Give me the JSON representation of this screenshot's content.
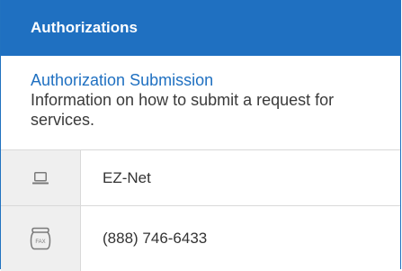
{
  "header": {
    "title": "Authorizations"
  },
  "info": {
    "link_text": "Authorization Submission",
    "description": "Information on how to submit a request for services."
  },
  "rows": [
    {
      "icon": "laptop-icon",
      "label": "EZ-Net"
    },
    {
      "icon": "fax-icon",
      "icon_text": "FAX",
      "label": "(888) 746-6433"
    }
  ],
  "colors": {
    "accent": "#1f70c1",
    "icon_gray": "#7a7a7a",
    "row_bg": "#efefef"
  }
}
